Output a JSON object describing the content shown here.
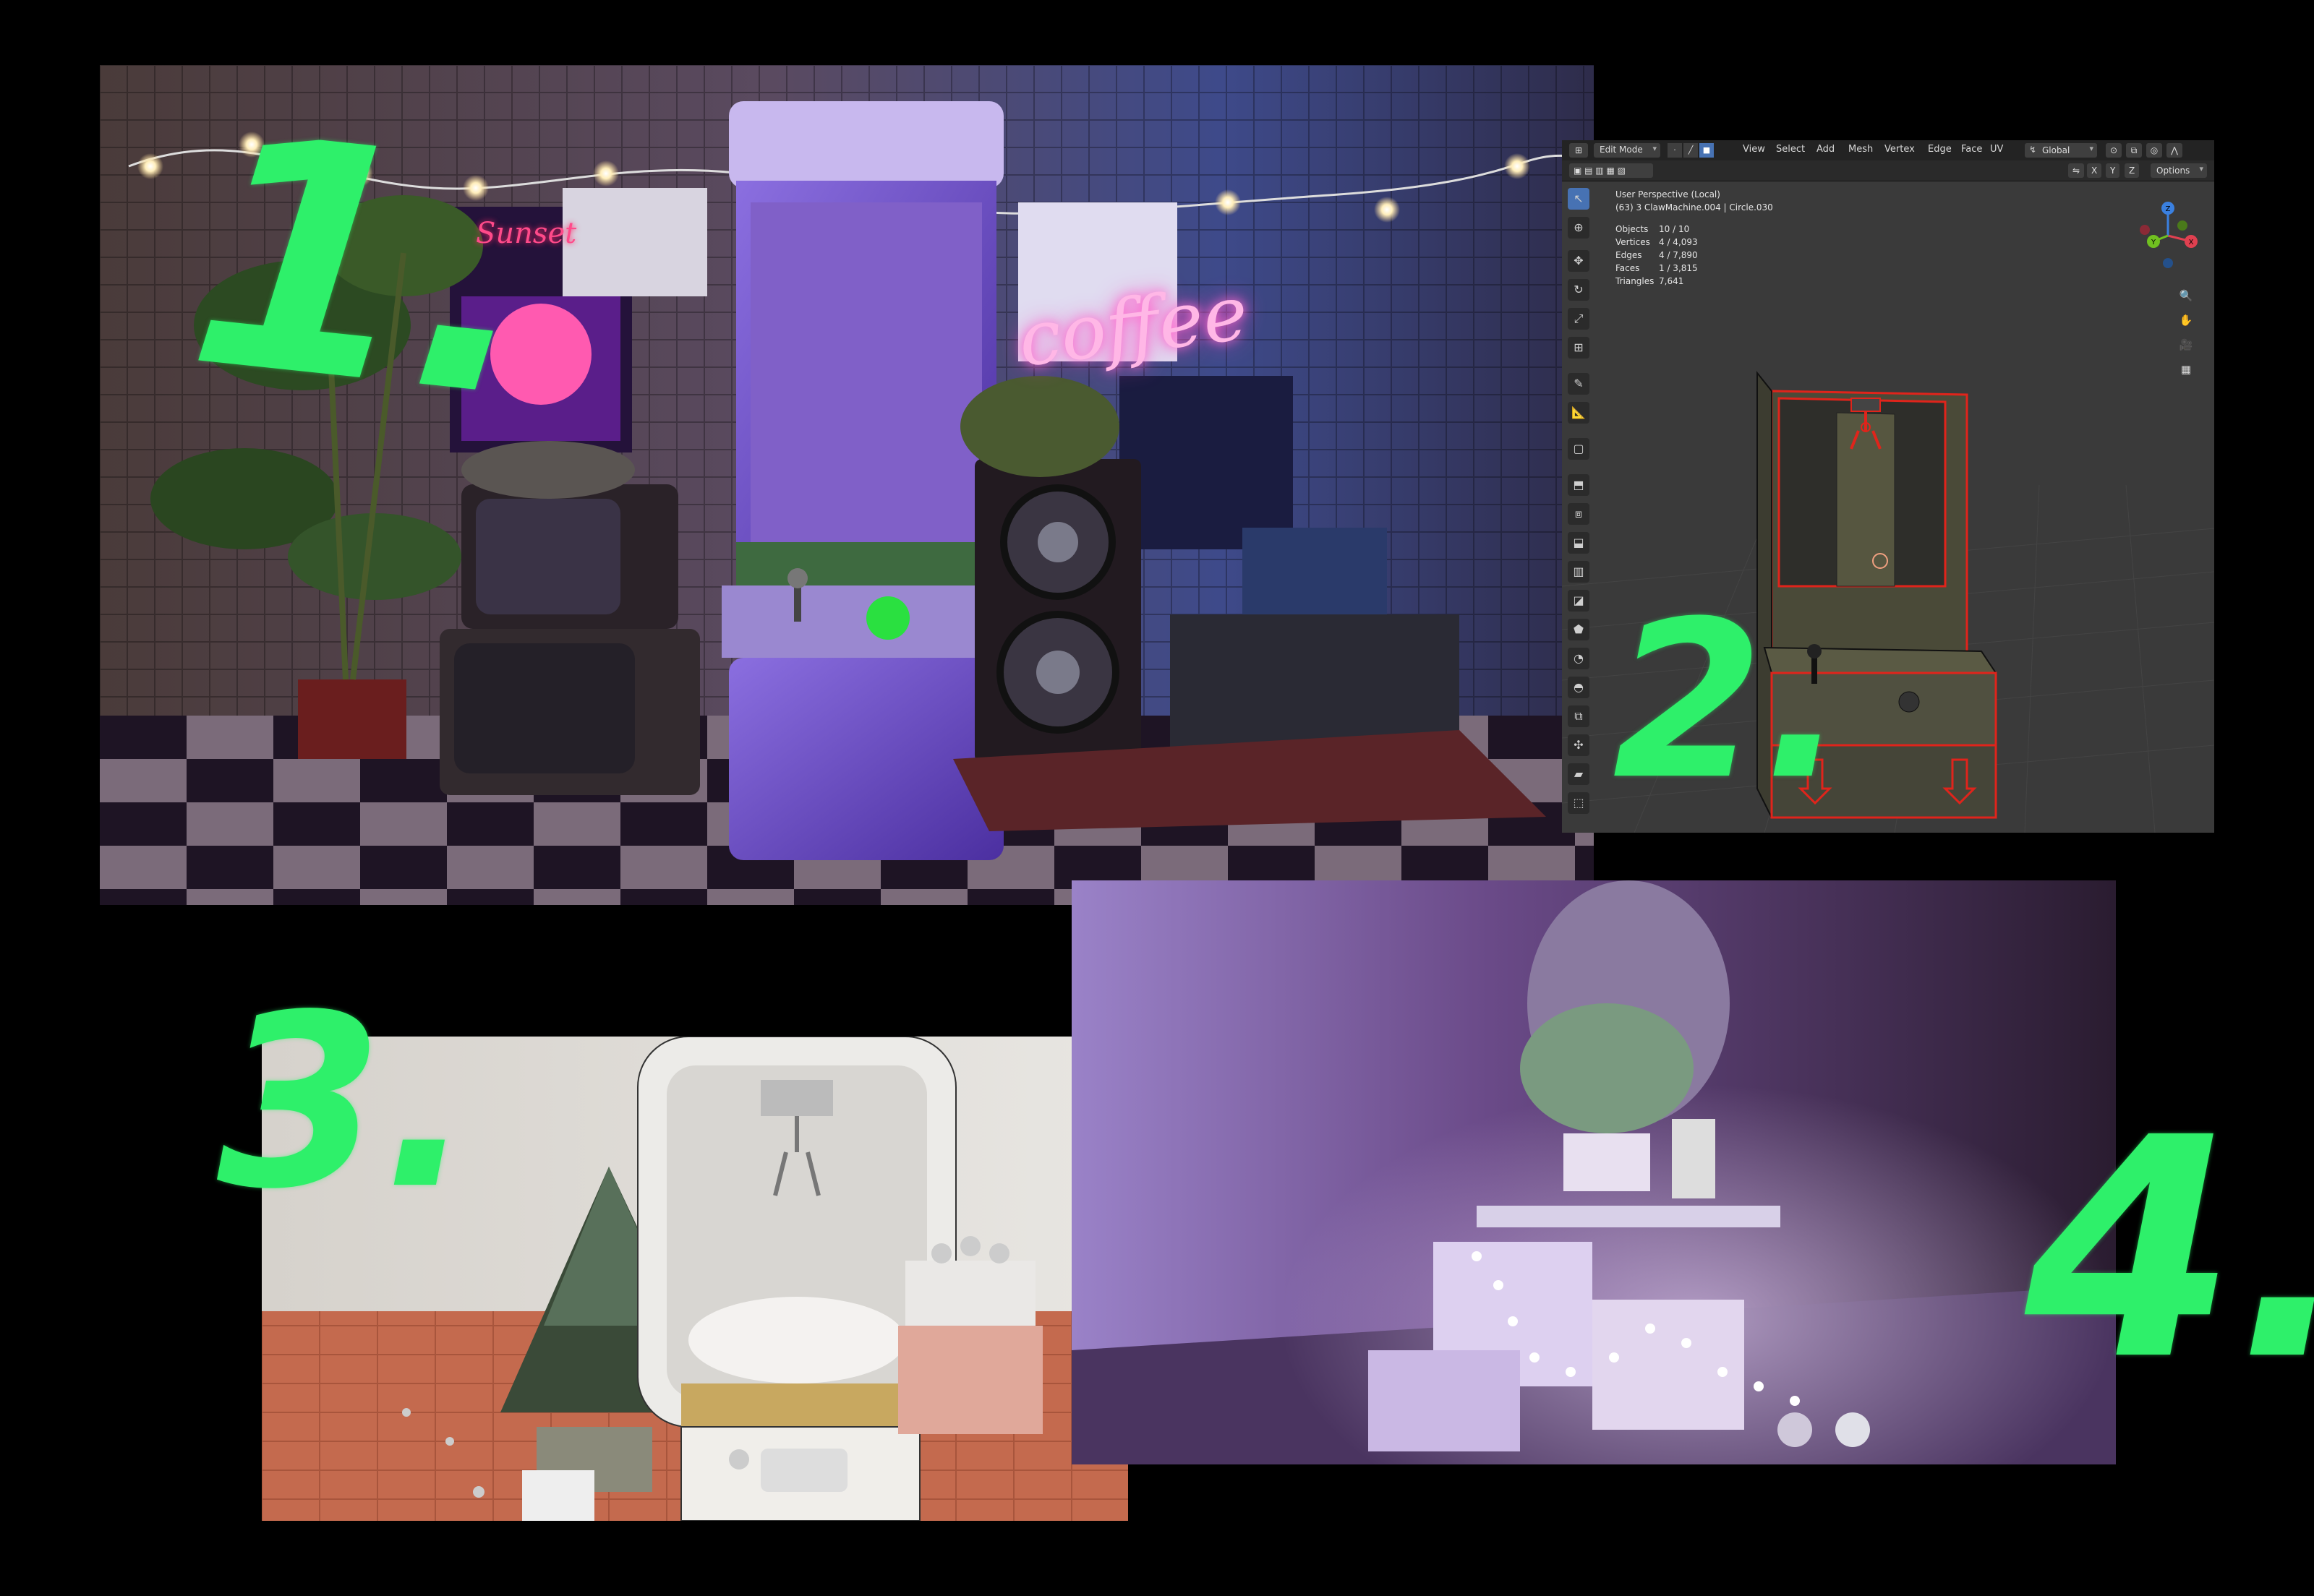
{
  "numbers": {
    "n1": "1.",
    "n2": "2.",
    "n3": "3.",
    "n4": "4."
  },
  "panel1": {
    "neon_sign": "coffee",
    "poster_text": "Sunset"
  },
  "blender": {
    "mode": "Edit Mode",
    "menus": [
      "View",
      "Select",
      "Add",
      "Mesh",
      "Vertex",
      "Edge",
      "Face",
      "UV"
    ],
    "transform_orientation": "Global",
    "options_label": "Options",
    "axes": [
      "X",
      "Y",
      "Z"
    ],
    "viewport_title": "User Perspective (Local)",
    "object_info": "(63) 3 ClawMachine.004 | Circle.030",
    "stats": [
      {
        "label": "Objects",
        "value": "10 / 10"
      },
      {
        "label": "Vertices",
        "value": "4 / 4,093"
      },
      {
        "label": "Edges",
        "value": "4 / 7,890"
      },
      {
        "label": "Faces",
        "value": "1 / 3,815"
      },
      {
        "label": "Triangles",
        "value": "7,641"
      }
    ],
    "gizmo_icons": [
      "zoom-icon",
      "hand-icon",
      "camera-icon",
      "grid-icon"
    ]
  },
  "colors": {
    "accent_green": "#2ef06a",
    "select_red": "#e0241b",
    "blender_active": "#4772b3"
  }
}
